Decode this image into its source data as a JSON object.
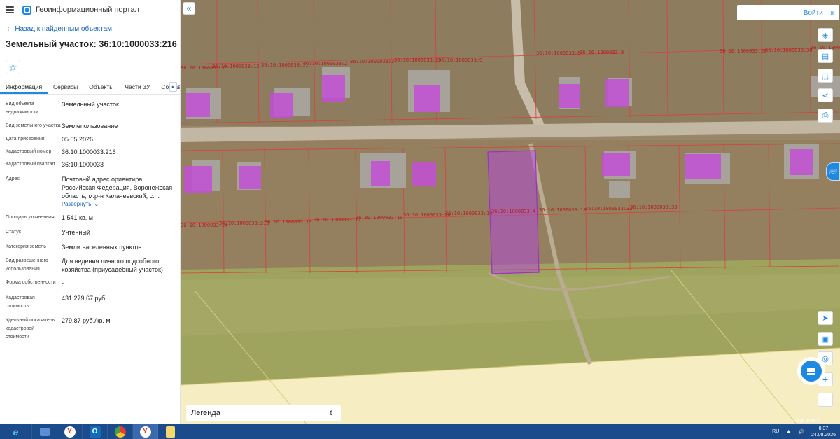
{
  "app": {
    "title": "Геоинформационный портал"
  },
  "nav": {
    "back_label": "Назад к найденным объектам"
  },
  "parcel": {
    "title": "Земельный участок: 36:10:1000033:216"
  },
  "tabs": [
    "Информация",
    "Сервисы",
    "Объекты",
    "Части ЗУ",
    "Состав"
  ],
  "attributes": [
    {
      "label": "Вид объекта недвижимости",
      "value": "Земельный участок"
    },
    {
      "label": "Вид земельного участка",
      "value": "Землепользование"
    },
    {
      "label": "Дата присвоения",
      "value": "05.05.2026"
    },
    {
      "label": "Кадастровый номер",
      "value": "36:10:1000033:216"
    },
    {
      "label": "Кадастровый квартал",
      "value": "36:10:1000033"
    },
    {
      "label": "Адрес",
      "value": "Почтовый адрес ориентира: Российская Федерация, Воронежская область, м.р-н Калачеевский, с.п."
    },
    {
      "label": "Площадь уточненная",
      "value": "1 541 кв. м"
    },
    {
      "label": "Статус",
      "value": "Учтенный"
    },
    {
      "label": "Категория земель",
      "value": "Земли населенных пунктов"
    },
    {
      "label": "Вид разрешенного использования",
      "value": "Для ведения личного подсобного хозяйства (приусадебный участок)"
    },
    {
      "label": "Форма собственности",
      "value": "-"
    },
    {
      "label": "Кадастровая стоимость",
      "value": "431 279,67 руб."
    },
    {
      "label": "Удельный показатель кадастровой стоимости",
      "value": "279,87 руб./кв. м"
    }
  ],
  "address_expand_label": "Развернуть",
  "map": {
    "login_label": "Войти",
    "legend_label": "Легенда",
    "copyright": "НСПД 2026 ©",
    "cadastral_labels": [
      "36:10:1000033:15",
      "36:10:1000033:13",
      "36:10:1000033:11",
      "36:10:1000033:2",
      "36:10:1000033:3",
      "36:10:1000033:20",
      "36:10:1000033:9",
      "36:10:1000033:6",
      "36:10:1000033:8",
      "36:10:1000033:28",
      "36:10:1000033:30",
      "36:10:1000033:27",
      "36:10:1000033:24",
      "36:10:1000033:216",
      "36:10:1000033:19",
      "36:10:1000033:12",
      "36:10:1000033:10",
      "36:10:1000033:26",
      "36:10:1000033:14",
      "36:10:1000033:4",
      "36:10:1000033:18",
      "36:10:1000033:32",
      "36:10:1000033:33"
    ]
  },
  "taskbar": {
    "lang": "RU",
    "time": "8:37",
    "date": "24.08.2026"
  },
  "colors": {
    "accent": "#1e88e5",
    "parcel_highlight": "#b04bd6",
    "boundary": "#d84040",
    "field_light": "#f7edc3"
  }
}
